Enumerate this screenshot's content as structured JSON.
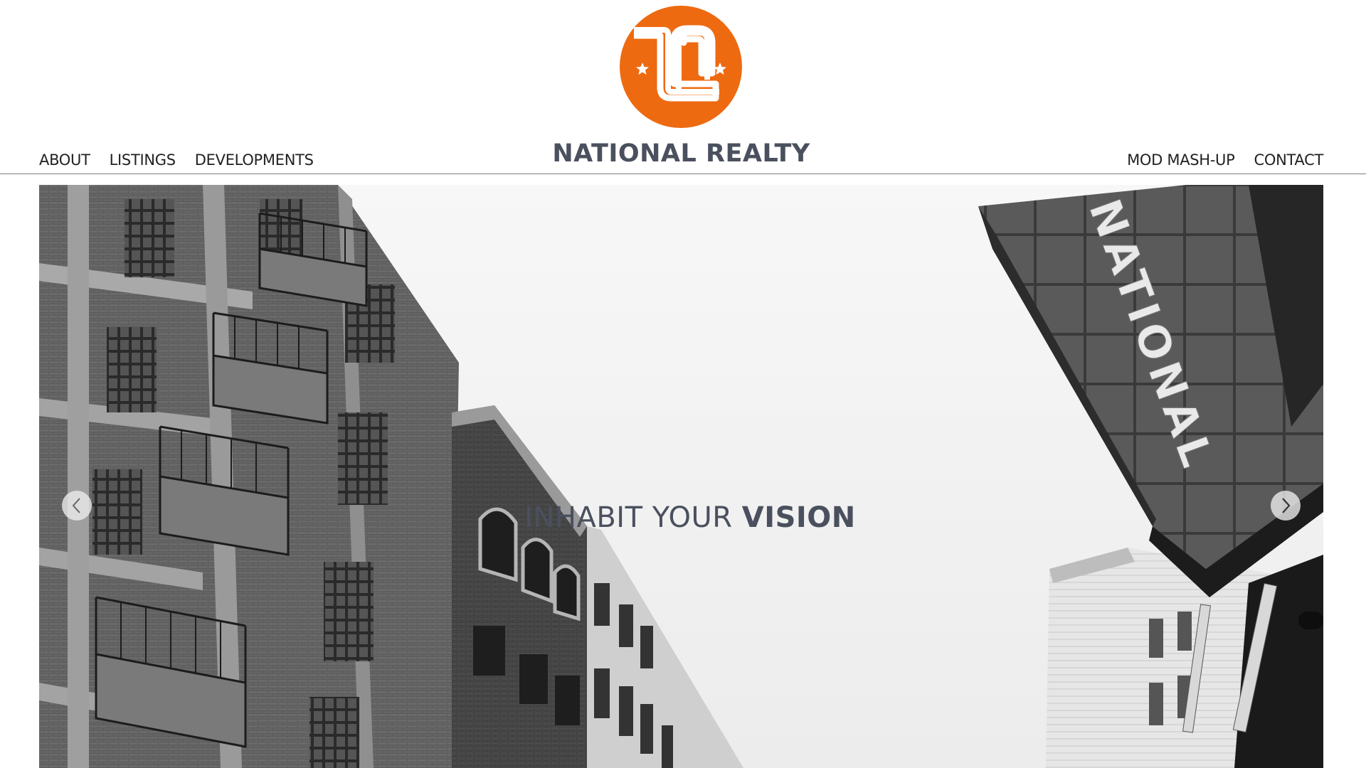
{
  "brand": {
    "name": "NATIONAL REALTY",
    "logo_icon": "national-realty-logo",
    "logo_color": "#ee6a10",
    "text_color": "#4a505e"
  },
  "nav": {
    "left": [
      {
        "label": "ABOUT"
      },
      {
        "label": "LISTINGS"
      },
      {
        "label": "DEVELOPMENTS"
      }
    ],
    "right": [
      {
        "label": "MOD MASH-UP"
      },
      {
        "label": "CONTACT"
      }
    ]
  },
  "hero": {
    "tagline_light": "INHABIT YOUR ",
    "tagline_bold": "VISION",
    "sign_text": "NATIONAL",
    "prev_icon": "chevron-left-icon",
    "next_icon": "chevron-right-icon"
  }
}
